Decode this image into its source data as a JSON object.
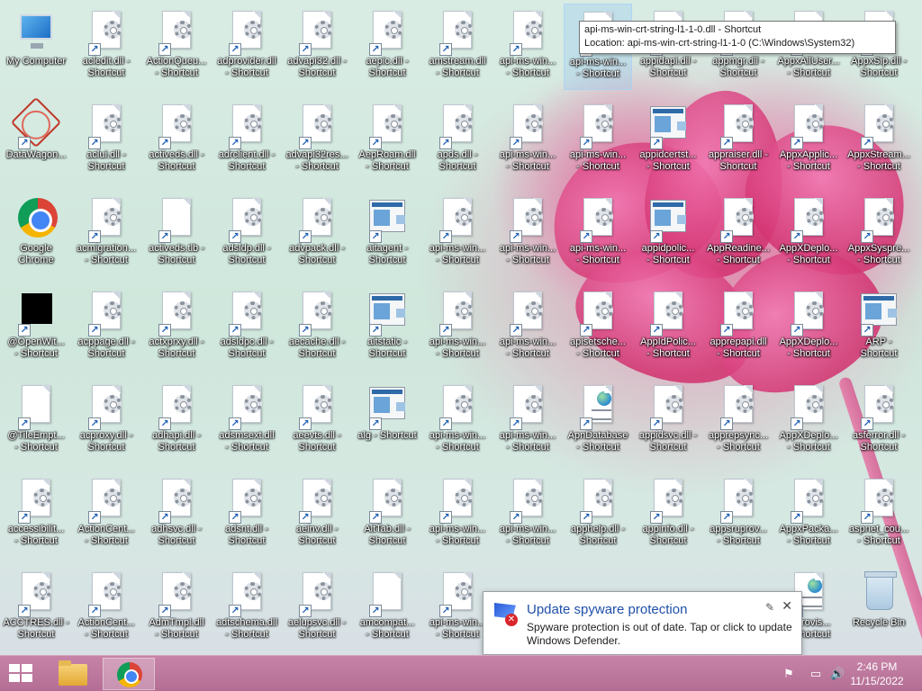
{
  "desktop": {
    "icons": [
      {
        "label": "My Computer",
        "type": "computer"
      },
      {
        "label": "acledit.dll -\nShortcut",
        "type": "gear"
      },
      {
        "label": "ActionQueu...\n- Shortcut",
        "type": "gear"
      },
      {
        "label": "adprovider.dll\n- Shortcut",
        "type": "gear"
      },
      {
        "label": "advapi32.dll -\nShortcut",
        "type": "gear"
      },
      {
        "label": "aepic.dll -\nShortcut",
        "type": "gear"
      },
      {
        "label": "amstream.dll\n- Shortcut",
        "type": "gear"
      },
      {
        "label": "api-ms-win...\n- Shortcut",
        "type": "gear"
      },
      {
        "label": "api-ms-win...\n- Shortcut",
        "type": "gear"
      },
      {
        "label": "appidapi.dll -\nShortcut",
        "type": "gear"
      },
      {
        "label": "appmgr.dll -\nShortcut",
        "type": "gear"
      },
      {
        "label": "AppxAllUser...\n- Shortcut",
        "type": "gear"
      },
      {
        "label": "AppxSip.dll -\nShortcut",
        "type": "gear"
      },
      {
        "label": "DataWagon...",
        "type": "datawagon"
      },
      {
        "label": "aclui.dll -\nShortcut",
        "type": "gear"
      },
      {
        "label": "activeds.dll -\nShortcut",
        "type": "gear"
      },
      {
        "label": "adrclient.dll -\nShortcut",
        "type": "gear"
      },
      {
        "label": "advapi32res...\n- Shortcut",
        "type": "gear"
      },
      {
        "label": "AepRoam.dll\n- Shortcut",
        "type": "gear"
      },
      {
        "label": "apds.dll -\nShortcut",
        "type": "gear"
      },
      {
        "label": "api-ms-win...\n- Shortcut",
        "type": "gear"
      },
      {
        "label": "api-ms-win...\n- Shortcut",
        "type": "gear"
      },
      {
        "label": "appidcertst...\n- Shortcut",
        "type": "app"
      },
      {
        "label": "appraiser.dll -\nShortcut",
        "type": "gear"
      },
      {
        "label": "AppxApplic...\n- Shortcut",
        "type": "gear"
      },
      {
        "label": "AppxStream...\n- Shortcut",
        "type": "gear"
      },
      {
        "label": "Google\nChrome",
        "type": "chrome"
      },
      {
        "label": "acmigration...\n- Shortcut",
        "type": "gear"
      },
      {
        "label": "activeds.tlb -\nShortcut",
        "type": "blank"
      },
      {
        "label": "adsldp.dll -\nShortcut",
        "type": "gear"
      },
      {
        "label": "advpack.dll -\nShortcut",
        "type": "gear"
      },
      {
        "label": "aitagent -\nShortcut",
        "type": "app"
      },
      {
        "label": "api-ms-win...\n- Shortcut",
        "type": "gear"
      },
      {
        "label": "api-ms-win...\n- Shortcut",
        "type": "gear"
      },
      {
        "label": "api-ms-win...\n- Shortcut",
        "type": "gear"
      },
      {
        "label": "appidpolic...\n- Shortcut",
        "type": "app"
      },
      {
        "label": "AppReadine...\n- Shortcut",
        "type": "gear"
      },
      {
        "label": "AppXDeplo...\n- Shortcut",
        "type": "gear"
      },
      {
        "label": "AppxSyspre...\n- Shortcut",
        "type": "gear"
      },
      {
        "label": "@OpenWit...\n- Shortcut",
        "type": "black"
      },
      {
        "label": "acppage.dll -\nShortcut",
        "type": "gear"
      },
      {
        "label": "actxprxy.dll -\nShortcut",
        "type": "gear"
      },
      {
        "label": "adsldpc.dll -\nShortcut",
        "type": "gear"
      },
      {
        "label": "aecache.dll -\nShortcut",
        "type": "gear"
      },
      {
        "label": "aitstatic -\nShortcut",
        "type": "app"
      },
      {
        "label": "api-ms-win...\n- Shortcut",
        "type": "gear"
      },
      {
        "label": "api-ms-win...\n- Shortcut",
        "type": "gear"
      },
      {
        "label": "apisetsche...\n- Shortcut",
        "type": "gear"
      },
      {
        "label": "AppIdPolic...\n- Shortcut",
        "type": "gear"
      },
      {
        "label": "apprepapi.dll\n- Shortcut",
        "type": "gear"
      },
      {
        "label": "AppXDeplo...\n- Shortcut",
        "type": "gear"
      },
      {
        "label": "ARP -\nShortcut",
        "type": "app"
      },
      {
        "label": "@TileEmpt...\n- Shortcut",
        "type": "blank"
      },
      {
        "label": "acproxy.dll -\nShortcut",
        "type": "gear"
      },
      {
        "label": "adhapi.dll -\nShortcut",
        "type": "gear"
      },
      {
        "label": "adsmsext.dll\n- Shortcut",
        "type": "gear"
      },
      {
        "label": "aeevts.dll -\nShortcut",
        "type": "gear"
      },
      {
        "label": "alg - Shortcut",
        "type": "app"
      },
      {
        "label": "api-ms-win...\n- Shortcut",
        "type": "gear"
      },
      {
        "label": "api-ms-win...\n- Shortcut",
        "type": "gear"
      },
      {
        "label": "ApnDatabase\n- Shortcut",
        "type": "webdoc"
      },
      {
        "label": "appidsvc.dll -\nShortcut",
        "type": "gear"
      },
      {
        "label": "apprepsync...\n- Shortcut",
        "type": "gear"
      },
      {
        "label": "AppXDeplo...\n- Shortcut",
        "type": "gear"
      },
      {
        "label": "asferror.dll -\nShortcut",
        "type": "gear"
      },
      {
        "label": "accessibilit...\n- Shortcut",
        "type": "gear"
      },
      {
        "label": "ActionCent...\n- Shortcut",
        "type": "gear"
      },
      {
        "label": "adhsvc.dll -\nShortcut",
        "type": "gear"
      },
      {
        "label": "adsnt.dll -\nShortcut",
        "type": "gear"
      },
      {
        "label": "aeinv.dll -\nShortcut",
        "type": "gear"
      },
      {
        "label": "AltTab.dll -\nShortcut",
        "type": "gear"
      },
      {
        "label": "api-ms-win...\n- Shortcut",
        "type": "gear"
      },
      {
        "label": "api-ms-win...\n- Shortcut",
        "type": "gear"
      },
      {
        "label": "apphelp.dll -\nShortcut",
        "type": "gear"
      },
      {
        "label": "appinfo.dll -\nShortcut",
        "type": "gear"
      },
      {
        "label": "appsruprov...\n- Shortcut",
        "type": "gear"
      },
      {
        "label": "AppxPacka...\n- Shortcut",
        "type": "gear"
      },
      {
        "label": "aspnet_cou...\n- Shortcut",
        "type": "gear"
      },
      {
        "label": "ACCTRES.dll -\nShortcut",
        "type": "gear"
      },
      {
        "label": "ActionCent...\n- Shortcut",
        "type": "gear"
      },
      {
        "label": "AdmTmpl.dll\n- Shortcut",
        "type": "gear"
      },
      {
        "label": "adtschema.dll\n- Shortcut",
        "type": "gear"
      },
      {
        "label": "aelupsvc.dll -\nShortcut",
        "type": "gear"
      },
      {
        "label": "amcompat...\n- Shortcut",
        "type": "blank"
      },
      {
        "label": "api-ms-win...\n- Shortcut",
        "type": "gear"
      },
      {
        "label": "...Provis...\n- Shortcut",
        "type": "webdoc"
      },
      {
        "label": "Recycle Bin",
        "type": "recycle"
      }
    ]
  },
  "tooltip": {
    "line1": "api-ms-win-crt-string-l1-1-0.dll - Shortcut",
    "line2": "Location: api-ms-win-crt-string-l1-1-0 (C:\\Windows\\System32)"
  },
  "notification": {
    "title": "Update spyware protection",
    "body": "Spyware protection is out of date. Tap or click to update Windows Defender.",
    "close": "✕",
    "pin": "✎"
  },
  "taskbar": {
    "start_label": "Start",
    "apps": [
      {
        "name": "File Explorer"
      },
      {
        "name": "Google Chrome"
      }
    ],
    "clock": {
      "time": "2:46 PM",
      "date": "11/15/2022"
    }
  },
  "colors": {
    "taskbar": "#b46e95",
    "notification_title": "#1f4fa8",
    "desktop_bg": "#d9ece4",
    "flower": "#e65a9a"
  }
}
